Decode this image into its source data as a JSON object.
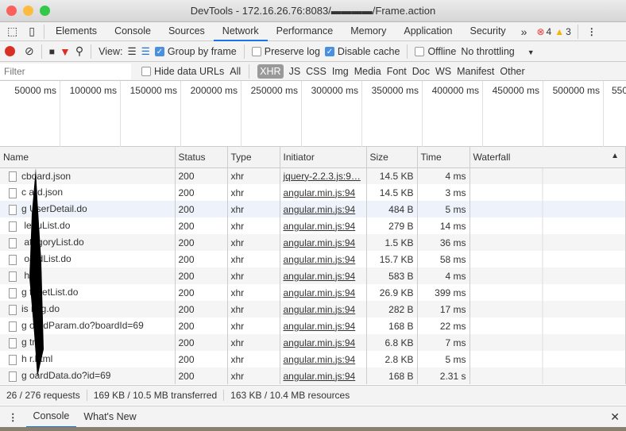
{
  "window": {
    "title": "DevTools - 172.16.26.76:8083/▬▬▬▬/Frame.action"
  },
  "tabs": [
    "Elements",
    "Console",
    "Sources",
    "Network",
    "Performance",
    "Memory",
    "Application",
    "Security"
  ],
  "active_tab": "Network",
  "more_tabs": "»",
  "errors": "4",
  "warnings": "3",
  "toolbar": {
    "view_label": "View:",
    "group_by_frame": "Group by frame",
    "preserve_log": "Preserve log",
    "disable_cache": "Disable cache",
    "offline": "Offline",
    "throttling": "No throttling",
    "group_by_frame_checked": true,
    "preserve_log_checked": false,
    "disable_cache_checked": true,
    "offline_checked": false
  },
  "filter": {
    "placeholder": "Filter",
    "hide_data_urls": "Hide data URLs",
    "types": [
      "All",
      "XHR",
      "JS",
      "CSS",
      "Img",
      "Media",
      "Font",
      "Doc",
      "WS",
      "Manifest",
      "Other"
    ],
    "active_type": "XHR"
  },
  "overview": {
    "ticks": [
      "50000 ms",
      "100000 ms",
      "150000 ms",
      "200000 ms",
      "250000 ms",
      "300000 ms",
      "350000 ms",
      "400000 ms",
      "450000 ms",
      "500000 ms",
      "550"
    ]
  },
  "table": {
    "columns": [
      "Name",
      "Status",
      "Type",
      "Initiator",
      "Size",
      "Time",
      "Waterfall"
    ],
    "rows": [
      [
        "cboard.json",
        "200",
        "xhr",
        "jquery-2.2.3.js:9…",
        "14.5 KB",
        "4 ms"
      ],
      [
        "c ard.json",
        "200",
        "xhr",
        "angular.min.js:94",
        "14.5 KB",
        "3 ms"
      ],
      [
        "g UserDetail.do",
        "200",
        "xhr",
        "angular.min.js:94",
        "484 B",
        "5 ms"
      ],
      [
        "  lenuList.do",
        "200",
        "xhr",
        "angular.min.js:94",
        "279 B",
        "14 ms"
      ],
      [
        "  ategoryList.do",
        "200",
        "xhr",
        "angular.min.js:94",
        "1.5 KB",
        "36 ms"
      ],
      [
        "  oardList.do",
        "200",
        "xhr",
        "angular.min.js:94",
        "15.7 KB",
        "58 ms"
      ],
      [
        "  html",
        "200",
        "xhr",
        "angular.min.js:94",
        "583 B",
        "4 ms"
      ],
      [
        "g  tasetList.do",
        "200",
        "xhr",
        "angular.min.js:94",
        "26.9 KB",
        "399 ms"
      ],
      [
        "is  nfig.do",
        "200",
        "xhr",
        "angular.min.js:94",
        "282 B",
        "17 ms"
      ],
      [
        "g  oardParam.do?boardId=69",
        "200",
        "xhr",
        "angular.min.js:94",
        "168 B",
        "22 ms"
      ],
      [
        "g  tml",
        "200",
        "xhr",
        "angular.min.js:94",
        "6.8 KB",
        "7 ms"
      ],
      [
        "h  r.html",
        "200",
        "xhr",
        "angular.min.js:94",
        "2.8 KB",
        "5 ms"
      ],
      [
        "g  oardData.do?id=69",
        "200",
        "xhr",
        "angular.min.js:94",
        "168 B",
        "2.31 s"
      ]
    ]
  },
  "status": {
    "requests": "26 / 276 requests",
    "transferred": "169 KB / 10.5 MB transferred",
    "resources": "163 KB / 10.4 MB resources"
  },
  "drawer": {
    "tabs": [
      "Console",
      "What's New"
    ]
  }
}
